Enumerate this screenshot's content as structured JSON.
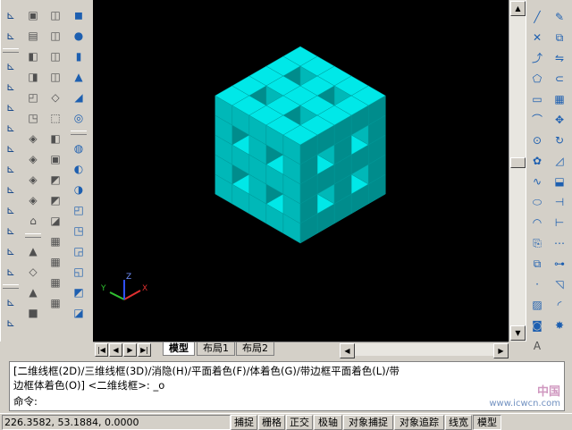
{
  "layout_tabs": {
    "model": "模型",
    "layout1": "布局1",
    "layout2": "布局2"
  },
  "command": {
    "line1": "[二维线框(2D)/三维线框(3D)/消隐(H)/平面着色(F)/体着色(G)/带边框平面着色(L)/带",
    "line2": "边框体着色(O)] <二维线框>: _o",
    "prompt": "命令:"
  },
  "ucs_labels": {
    "x": "X",
    "y": "Y",
    "z": "Z"
  },
  "status": {
    "coordinates": "226.3582,  53.1884,  0.0000",
    "toggles": [
      "捕捉",
      "栅格",
      "正交",
      "极轴",
      "对象捕捉",
      "对象追踪",
      "线宽",
      "模型"
    ]
  },
  "watermark": {
    "text1": "中国",
    "text2": "www.icwcn.com"
  },
  "colors": {
    "model_fill": "#00e8e8",
    "model_shade": "#00b8b8",
    "model_dark": "#008c8c",
    "canvas": "#000000",
    "gizmo_x": "#e03030",
    "gizmo_y": "#30c030",
    "gizmo_z": "#3050ff"
  },
  "toolbars": {
    "col1": [
      "ucs-icon",
      "ucs-previous-icon",
      "ucs-world-icon",
      "ucs-object-icon",
      "ucs-face-icon",
      "ucs-view-icon",
      "ucs-origin-icon",
      "ucs-zaxis-icon",
      "ucs-3point-icon",
      "ucs-x-icon",
      "ucs-y-icon",
      "ucs-z-icon",
      "ucs-apply-icon",
      "ucs-named-icon",
      "ucs-preset-icon"
    ],
    "col2": [
      "top-view-icon",
      "bottom-view-icon",
      "left-view-icon",
      "right-view-icon",
      "front-view-icon",
      "back-view-icon",
      "sw-iso-icon",
      "se-iso-icon",
      "ne-iso-icon",
      "nw-iso-icon",
      "camera-icon",
      "hide-icon",
      "render-icon",
      "light-icon",
      "scene-icon"
    ],
    "col3": [
      "box-icon",
      "sphere-icon",
      "cylinder-icon",
      "cone-icon",
      "wedge-icon",
      "torus-icon",
      "extrude-icon",
      "revolve-icon",
      "section-icon",
      "slice-icon",
      "interfere-icon",
      "setup-drawing-icon",
      "setup-view-icon",
      "setup-profile-icon",
      "solid-edit-icon"
    ],
    "col4": [
      "box3d-icon",
      "sphere3d-icon",
      "cylinder3d-icon",
      "cone3d-icon",
      "wedge3d-icon",
      "torus3d-icon",
      "union-icon",
      "subtract-icon",
      "intersect-icon",
      "extrude-faces-icon",
      "move-faces-icon",
      "offset-faces-icon",
      "delete-faces-icon",
      "rotate-faces-icon",
      "taper-faces-icon"
    ],
    "right1": [
      "line-icon",
      "construction-line-icon",
      "polyline-icon",
      "polygon-icon",
      "rectangle-icon",
      "arc-icon",
      "circle-icon",
      "revcloud-icon",
      "spline-icon",
      "ellipse-icon",
      "ellipse-arc-icon",
      "insert-block-icon",
      "make-block-icon",
      "point-icon",
      "hatch-icon",
      "region-icon",
      "mtext-icon"
    ],
    "right2": [
      "erase-icon",
      "copy-icon",
      "mirror-icon",
      "offset-icon",
      "array-icon",
      "move-icon",
      "rotate-icon",
      "scale-icon",
      "stretch-icon",
      "trim-icon",
      "extend-icon",
      "break-icon",
      "join-icon",
      "chamfer-icon",
      "fillet-icon",
      "explode-icon"
    ]
  }
}
